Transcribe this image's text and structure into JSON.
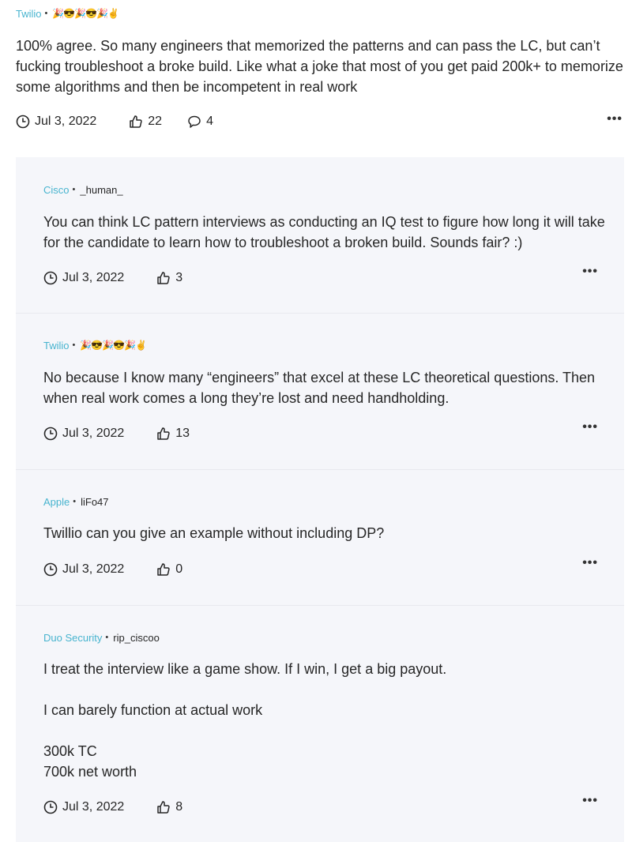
{
  "post": {
    "company": "Twilio",
    "separator": "•",
    "author_emoji": "🎉😎🎉😎🎉✌️",
    "text": "100% agree. So many engineers that memorized the patterns and can pass the LC, but can’t fucking troubleshoot a broke build. Like what a joke that most of you get paid 200k+ to memorize some algorithms and then be incompetent in real work",
    "date": "Jul 3, 2022",
    "likes": "22",
    "comments": "4",
    "more_label": "•••"
  },
  "replies": [
    {
      "company": "Cisco",
      "separator": "•",
      "author": "_human_",
      "text": "You can think LC pattern interviews as conducting an IQ test to figure how long it will take for the candidate to learn how to troubleshoot a broken build. Sounds fair? :)",
      "date": "Jul 3, 2022",
      "likes": "3",
      "more_label": "•••"
    },
    {
      "company": "Twilio",
      "separator": "•",
      "author": "🎉😎🎉😎🎉✌️",
      "text": "No because I know many “engineers” that excel at these LC theoretical questions. Then when real work comes a long they’re lost and need handholding.",
      "date": "Jul 3, 2022",
      "likes": "13",
      "more_label": "•••"
    },
    {
      "company": "Apple",
      "separator": "•",
      "author": "liFo47",
      "text": "Twillio can you give an example without including DP?",
      "date": "Jul 3, 2022",
      "likes": "0",
      "more_label": "•••"
    },
    {
      "company": "Duo Security",
      "separator": "•",
      "author": "rip_ciscoo",
      "text": "I treat the interview like a game show. If I win, I get a big payout.\n\nI can barely function at actual work\n\n300k TC\n700k net worth",
      "date": "Jul 3, 2022",
      "likes": "8",
      "more_label": "•••"
    }
  ]
}
